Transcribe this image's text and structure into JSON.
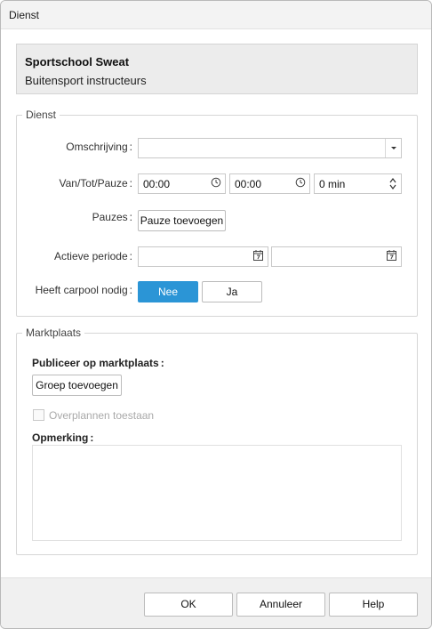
{
  "window": {
    "title": "Dienst"
  },
  "header": {
    "organization": "Sportschool Sweat",
    "department": "Buitensport instructeurs"
  },
  "dienst": {
    "legend": "Dienst",
    "omschrijving": {
      "label": "Omschrijving",
      "value": ""
    },
    "van_tot_pauze": {
      "label": "Van/Tot/Pauze",
      "van": "00:00",
      "tot": "00:00",
      "pauze": "0 min"
    },
    "pauzes": {
      "label": "Pauzes",
      "add_button": "Pauze toevoegen"
    },
    "actieve_periode": {
      "label": "Actieve periode",
      "start": "",
      "end": ""
    },
    "carpool": {
      "label": "Heeft carpool nodig",
      "no": "Nee",
      "yes": "Ja",
      "selected": "Nee"
    }
  },
  "marktplaats": {
    "legend": "Marktplaats",
    "publiceer_label": "Publiceer op marktplaats",
    "groep_button": "Groep toevoegen",
    "overplannen_label": "Overplannen toestaan",
    "overplannen_checked": false,
    "opmerking_label": "Opmerking",
    "opmerking_value": ""
  },
  "footer": {
    "ok": "OK",
    "cancel": "Annuleer",
    "help": "Help"
  },
  "colors": {
    "accent": "#2b95d6",
    "header_bg": "#ececec"
  },
  "icons": {
    "dropdown": "chevron-down-icon",
    "time": "clock-icon",
    "spinner": "spinner-arrows-icon",
    "date": "calendar-icon"
  }
}
